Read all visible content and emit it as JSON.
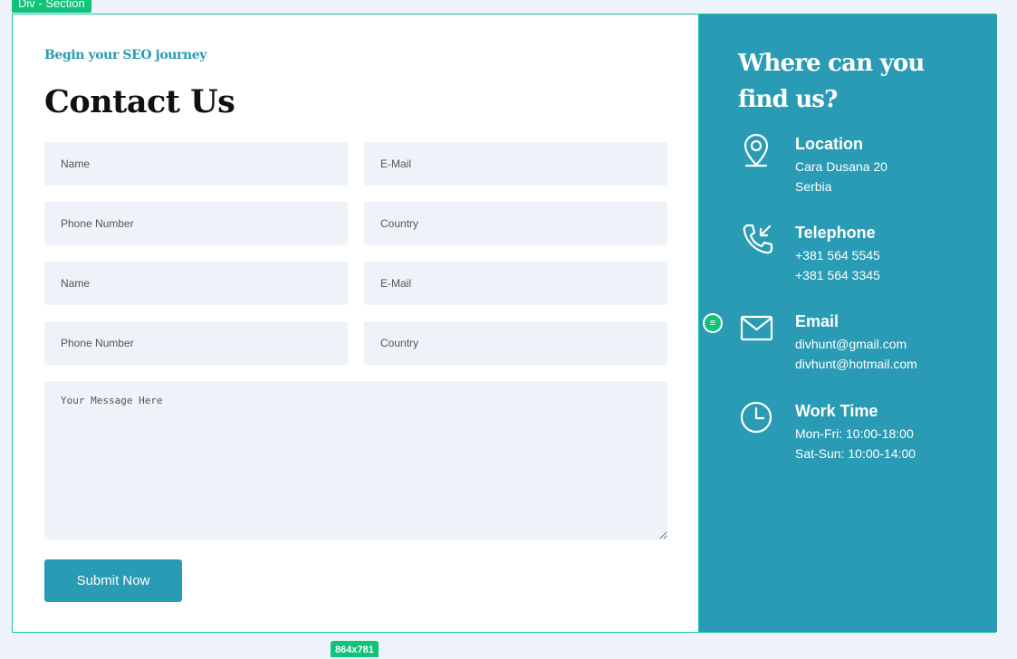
{
  "editor": {
    "element_label": "Div - Section",
    "size_label": "864x781",
    "handle_glyph": "≡"
  },
  "form": {
    "eyebrow": "Begin your SEO journey",
    "title": "Contact Us",
    "fields": {
      "row1_left": "Name",
      "row1_right": "E-Mail",
      "row2_left": "Phone Number",
      "row2_right": "Country",
      "row3_left": "Name",
      "row3_right": "E-Mail",
      "row4_left": "Phone Number",
      "row4_right": "Country"
    },
    "message_placeholder": "Your Message Here",
    "submit_label": "Submit Now"
  },
  "sidebar": {
    "title": "Where can you find us?",
    "items": [
      {
        "icon": "location-pin-icon",
        "heading": "Location",
        "line1": "Cara Dusana 20",
        "line2": "Serbia"
      },
      {
        "icon": "phone-incoming-icon",
        "heading": "Telephone",
        "line1": "+381 564 5545",
        "line2": "+381 564 3345"
      },
      {
        "icon": "envelope-icon",
        "heading": "Email",
        "line1": "divhunt@gmail.com",
        "line2": "divhunt@hotmail.com"
      },
      {
        "icon": "clock-icon",
        "heading": "Work Time",
        "line1": "Mon-Fri: 10:00-18:00",
        "line2": "Sat-Sun: 10:00-14:00"
      }
    ]
  },
  "colors": {
    "accent": "#2a9bb4",
    "field_bg": "#eef3f9",
    "editor_green": "#10c27a"
  }
}
